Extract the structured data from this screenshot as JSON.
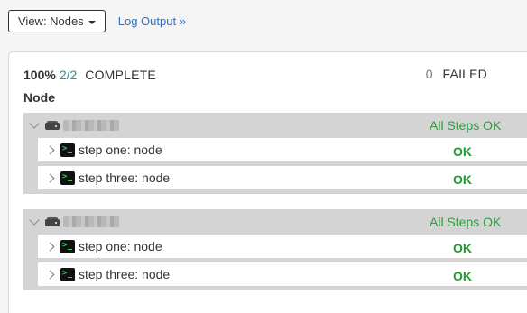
{
  "toolbar": {
    "view_label": "View: Nodes",
    "log_link": "Log Output »"
  },
  "summary": {
    "percent": "100%",
    "count": "2/2",
    "complete_label": "COMPLETE",
    "failed_count": "0",
    "failed_label": "FAILED"
  },
  "section_title": "Node",
  "nodes": [
    {
      "name": "redacted-host-1",
      "status": "All Steps OK",
      "steps": [
        {
          "label": "step one: node",
          "status": "OK"
        },
        {
          "label": "step three: node",
          "status": "OK"
        }
      ]
    },
    {
      "name": "redacted-host-2",
      "status": "All Steps OK",
      "steps": [
        {
          "label": "step one: node",
          "status": "OK"
        },
        {
          "label": "step three: node",
          "status": "OK"
        }
      ]
    }
  ],
  "colors": {
    "link": "#2a6ec9",
    "count": "#2a8fa0",
    "ok": "#1f9a2f",
    "all_ok": "#2e9e3e",
    "group_bg": "#d4d4d4"
  },
  "icons": {
    "node": "server-icon",
    "step": "terminal-icon",
    "expand_node": "chevron-down-icon",
    "expand_step": "chevron-right-icon"
  }
}
